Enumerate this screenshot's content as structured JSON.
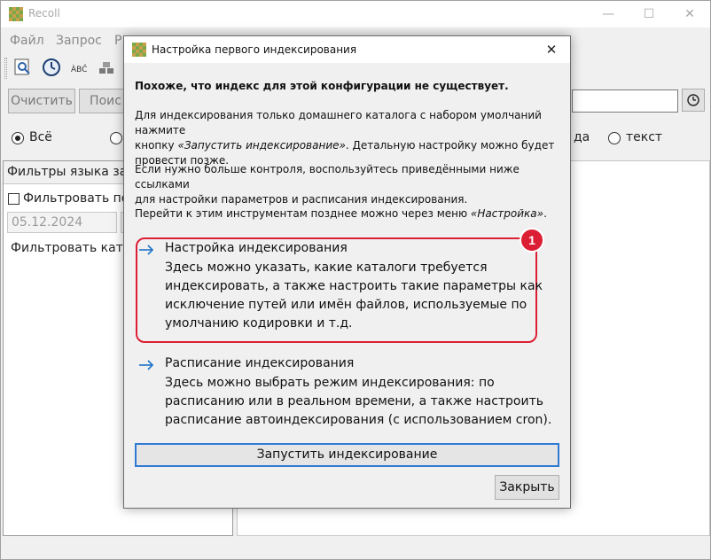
{
  "main": {
    "title": "Recoll",
    "window_controls": {
      "minimize": "—",
      "maximize": "☐",
      "close": "✕"
    },
    "menu": [
      "Файл",
      "Запрос",
      "Р"
    ],
    "buttons": {
      "clear": "Очистить",
      "search": "Поис"
    },
    "radios": {
      "all": "Всё",
      "text": "текст",
      "partial": "да"
    },
    "filters_header": "Фильтры языка запр",
    "filter_date_label": "Фильтровать по",
    "date_value": "05.12.2024",
    "filter_catalog_label": "Фильтровать ката"
  },
  "dialog": {
    "title": "Настройка первого индексирования",
    "close_glyph": "✕",
    "heading": "Похоже, что индекс для этой конфигурации не существует.",
    "para1_line1": "Для индексирования только домашнего каталога с набором умолчаний нажмите",
    "para1_prefix": "кнопку ",
    "para1_em": "«Запустить индексирование»",
    "para1_suffix": ". Детальную настройку можно будет",
    "para1_line3": "провести позже.",
    "para2_line1": "Если нужно больше контроля, воспользуйтесь приведёнными ниже ссылками",
    "para2_line2": "для настройки параметров и расписания индексирования.",
    "para3_prefix": "Перейти к этим инструментам позднее можно через меню ",
    "para3_em": "«Настройка»",
    "para3_suffix": ".",
    "link1": {
      "title": "Настройка индексирования",
      "desc": "Здесь можно указать, какие каталоги требуется индексировать, а также настроить такие параметры как исключение путей или имён файлов, используемые по умолчанию кодировки и т.д."
    },
    "link2": {
      "title": "Расписание индексирования",
      "desc": "Здесь можно выбрать режим индексирования: по расписанию или в реальном времени, а также настроить расписание автоиндексирования (с использованием cron)."
    },
    "badge": "1",
    "start_button": "Запустить индексирование",
    "close_button": "Закрыть"
  },
  "colors": {
    "accent": "#2f7bd4",
    "highlight": "#dc1e35",
    "link_arrow": "#1e73c8"
  },
  "icons": [
    "app-logo-icon",
    "search-tool-icon",
    "clock-tool-icon",
    "spellcheck-icon",
    "index-stack-icon",
    "arrow-right-icon",
    "close-icon"
  ]
}
